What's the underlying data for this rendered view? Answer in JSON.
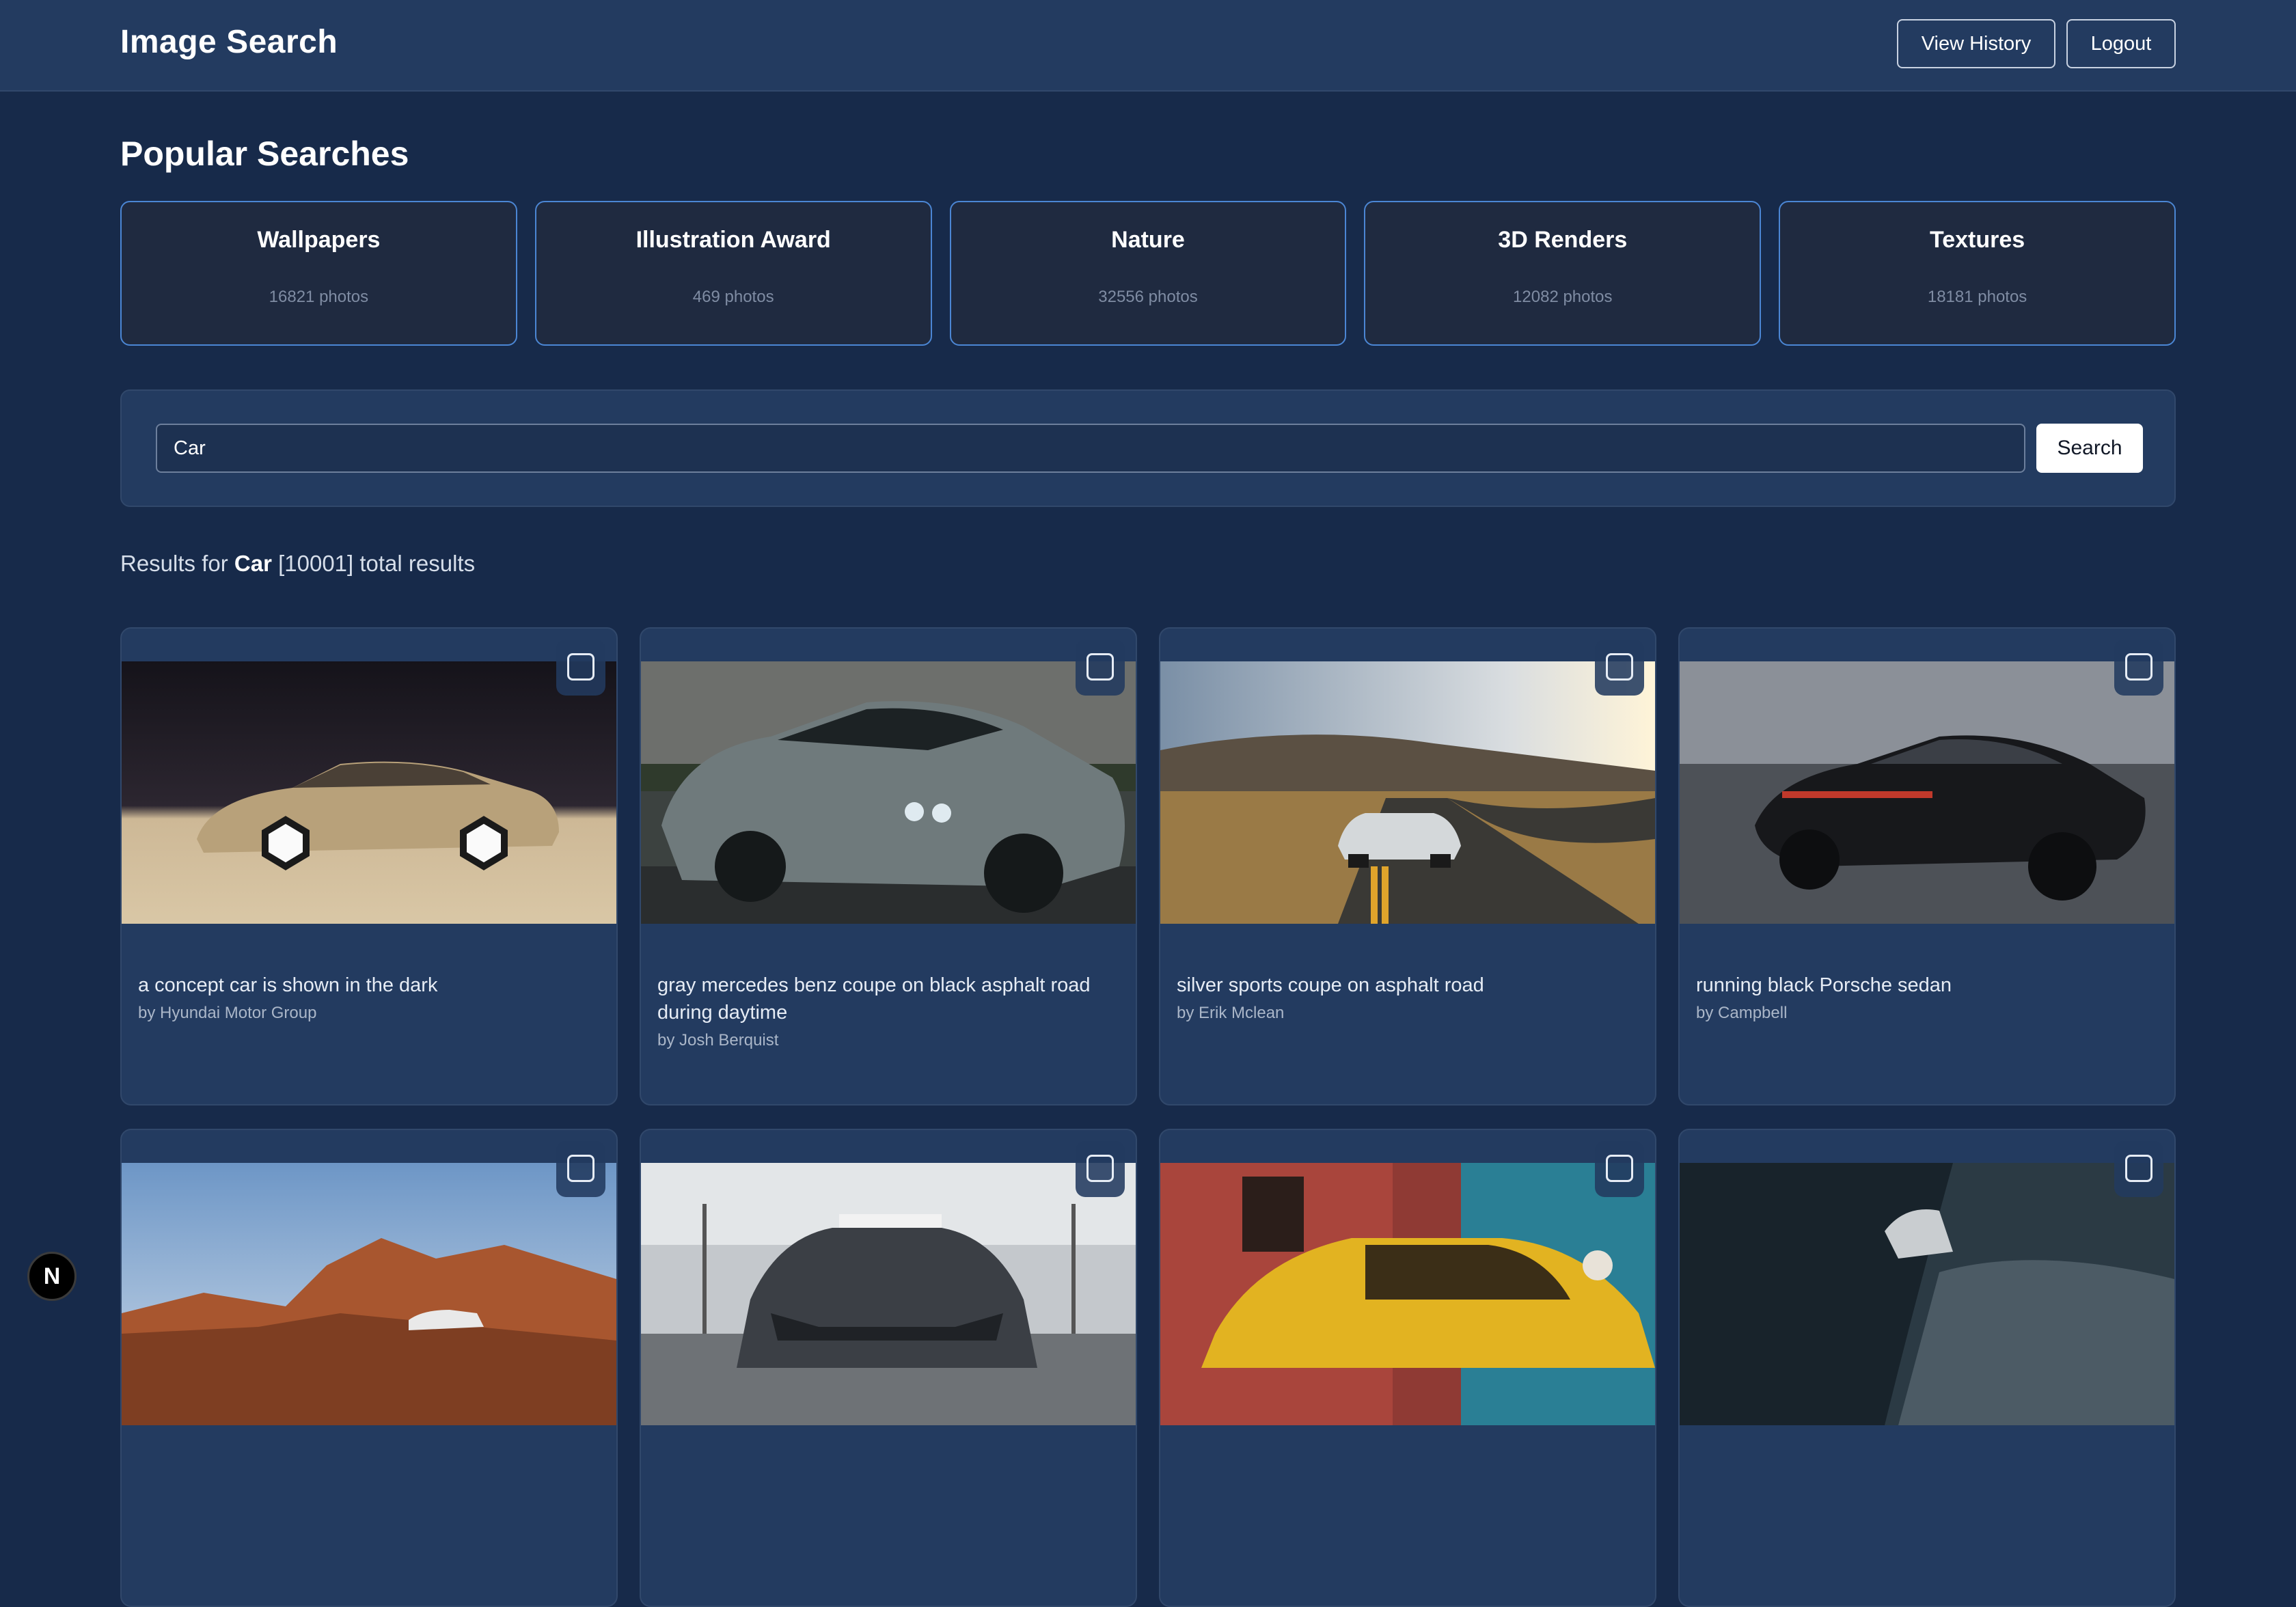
{
  "header": {
    "title": "Image Search",
    "view_history_label": "View History",
    "logout_label": "Logout"
  },
  "popular": {
    "title": "Popular Searches",
    "items": [
      {
        "name": "Wallpapers",
        "count": "16821 photos"
      },
      {
        "name": "Illustration Award",
        "count": "469 photos"
      },
      {
        "name": "Nature",
        "count": "32556 photos"
      },
      {
        "name": "3D Renders",
        "count": "12082 photos"
      },
      {
        "name": "Textures",
        "count": "18181 photos"
      }
    ]
  },
  "search": {
    "value": "Car",
    "button_label": "Search"
  },
  "results": {
    "prefix": "Results for",
    "query": "Car",
    "suffix": "[10001] total results"
  },
  "cards": [
    {
      "description": "a concept car is shown in the dark",
      "author": "by Hyundai Motor Group"
    },
    {
      "description": "gray mercedes benz coupe on black asphalt road during daytime",
      "author": "by Josh Berquist"
    },
    {
      "description": "silver sports coupe on asphalt road",
      "author": "by Erik Mclean"
    },
    {
      "description": "running black Porsche sedan",
      "author": "by Campbell"
    },
    {
      "description": "",
      "author": ""
    },
    {
      "description": "",
      "author": ""
    },
    {
      "description": "",
      "author": ""
    },
    {
      "description": "",
      "author": ""
    }
  ],
  "badge": {
    "letter": "N"
  }
}
